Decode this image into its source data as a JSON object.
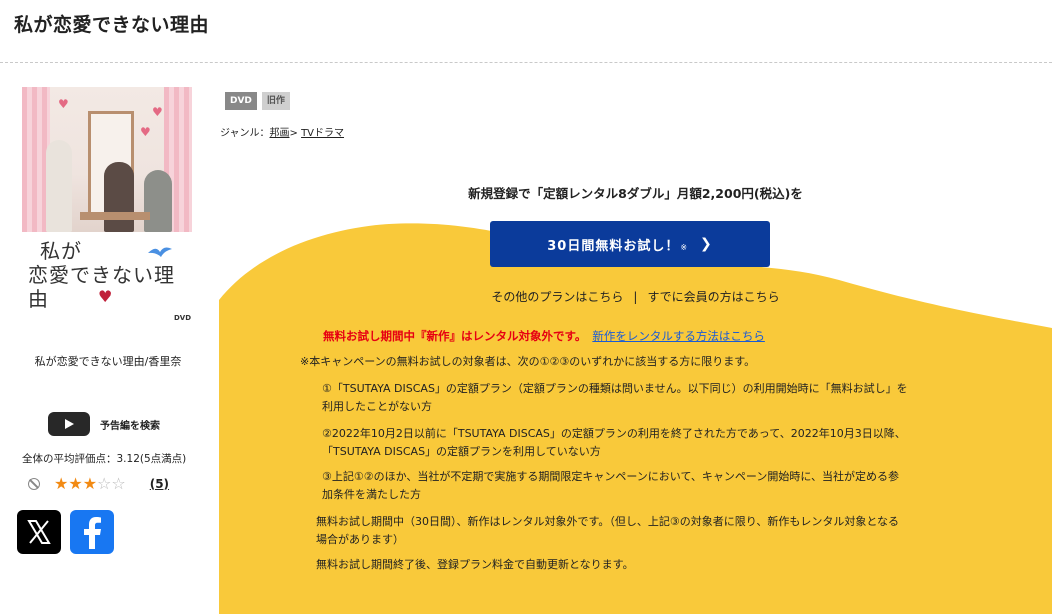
{
  "page": {
    "title": "私が恋愛できない理由"
  },
  "cover": {
    "logo_line1": "私が",
    "logo_line2": "恋愛できない理由",
    "dvd_mark": "DVD"
  },
  "product": {
    "name": "私が恋愛できない理由/香里奈"
  },
  "trailer": {
    "label": "予告編を検索",
    "icon": "youtube-play-icon"
  },
  "rating": {
    "average_label": "全体の平均評価点：3.12(5点満点)",
    "score": 3.12,
    "max": 5,
    "count_label": "(5)"
  },
  "social": {
    "x_icon": "x-logo-icon",
    "facebook_icon": "facebook-logo-icon"
  },
  "badges": [
    "DVD",
    "旧作"
  ],
  "genre": {
    "prefix": "ジャンル：",
    "level1": "邦画",
    "separator": "> ",
    "level2": "TVドラマ"
  },
  "campaign": {
    "headline": "新規登録で「定額レンタル8ダブル」月額2,200円(税込)を",
    "button_label": "30日間無料お試し！",
    "button_note": "※",
    "other_plans": "その他のプランはこちら",
    "separator": "|",
    "members": "すでに会員の方はこちら",
    "warning": "無料お試し期間中『新作』はレンタル対象外です。",
    "warning_link": "新作をレンタルする方法はこちら",
    "note_intro": "※本キャンペーンの無料お試しの対象者は、次の①②③のいずれかに該当する方に限ります。",
    "cond1_line1": "①「TSUTAYA DISCAS」の定額プラン（定額プランの種類は問いません。以下同じ）の利用開始時に「無料お試し」を",
    "cond1_line2": "利用したことがない方",
    "cond2_line1": "②2022年10月2日以前に「TSUTAYA DISCAS」の定額プランの利用を終了された方であって、2022年10月3日以降、",
    "cond2_line2": "「TSUTAYA DISCAS」の定額プランを利用していない方",
    "cond3_line1": "③上記①②のほか、当社が不定期で実施する期間限定キャンペーンにおいて、キャンペーン開始時に、当社が定める参",
    "cond3_line2": "加条件を満たした方",
    "note2_line1": "無料お試し期間中（30日間）、新作はレンタル対象外です。（但し、上記③の対象者に限り、新作もレンタル対象となる",
    "note2_line2": "場合があります）",
    "note3": "無料お試し期間終了後、登録プラン料金で自動更新となります。"
  },
  "colors": {
    "campaign_yellow": "#f9c93a",
    "button_blue": "#0b3b9b",
    "warning_red": "#e60012",
    "link_blue": "#1a5bd6",
    "star_orange": "#f28a13"
  }
}
